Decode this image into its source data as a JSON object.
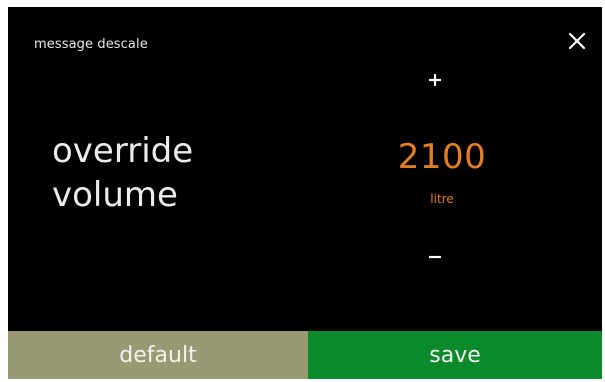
{
  "header": {
    "title": "message descale",
    "close_icon": "close-icon"
  },
  "setting": {
    "label_line1": "override",
    "label_line2": "volume",
    "value": "2100",
    "unit": "litre",
    "increment_icon": "plus-icon",
    "decrement_icon": "minus-icon"
  },
  "footer": {
    "default_label": "default",
    "save_label": "save"
  },
  "colors": {
    "background": "#000000",
    "value_accent": "#e37e26",
    "default_button": "#9a9a72",
    "save_button": "#0b8a2c"
  }
}
